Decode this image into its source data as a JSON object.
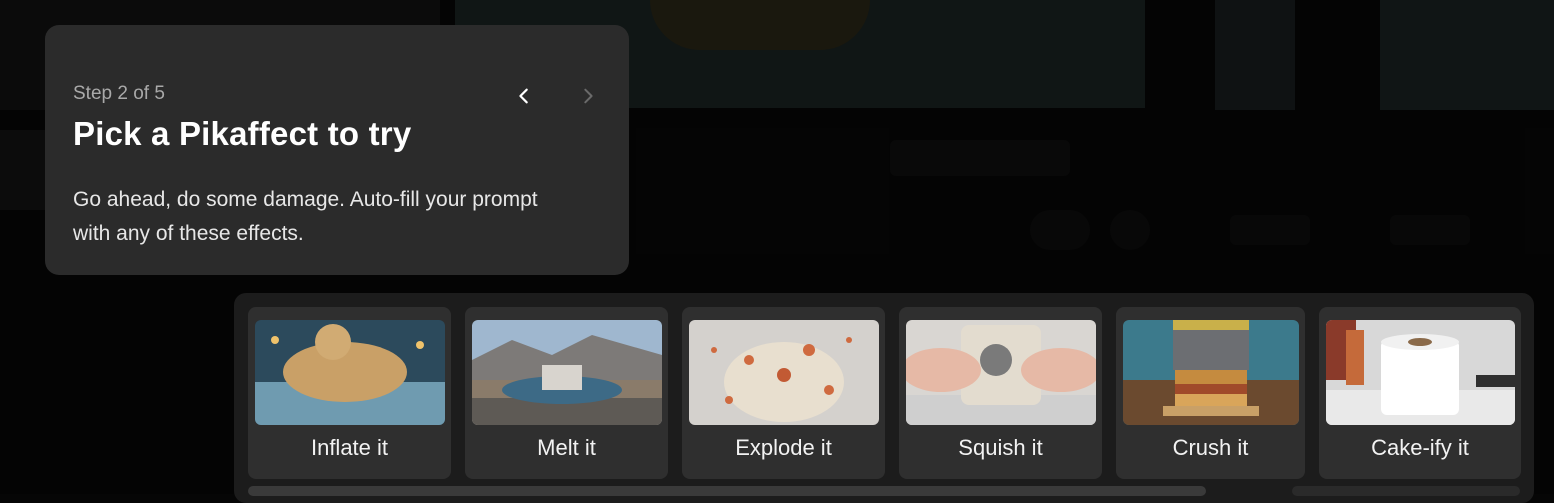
{
  "tour": {
    "step": "Step 2 of 5",
    "title": "Pick a Pikaffect to try",
    "body": "Go ahead, do some damage. Auto-fill your prompt with any of these effects.",
    "prev_icon": "chevron-left-icon",
    "next_icon": "chevron-right-icon"
  },
  "effects": [
    {
      "label": "Inflate it",
      "colors": [
        "#3d5f74",
        "#c9a067",
        "#6f9bb0"
      ]
    },
    {
      "label": "Melt it",
      "colors": [
        "#8fa8c4",
        "#8a7b6a",
        "#5c87a6"
      ]
    },
    {
      "label": "Explode it",
      "colors": [
        "#c9c6c2",
        "#cf6a3f",
        "#e2d9c9"
      ]
    },
    {
      "label": "Squish it",
      "colors": [
        "#d8c3bb",
        "#e6b9a6",
        "#cfcfcf"
      ]
    },
    {
      "label": "Crush it",
      "colors": [
        "#3c7a8c",
        "#6c6e72",
        "#c58b3f"
      ]
    },
    {
      "label": "Cake-ify it",
      "colors": [
        "#d8d8d8",
        "#ffffff",
        "#2f2f2f"
      ]
    }
  ],
  "theme": {
    "panel": "#1c1c1c",
    "card": "#2f2f2f",
    "popover": "#2b2b2b"
  }
}
